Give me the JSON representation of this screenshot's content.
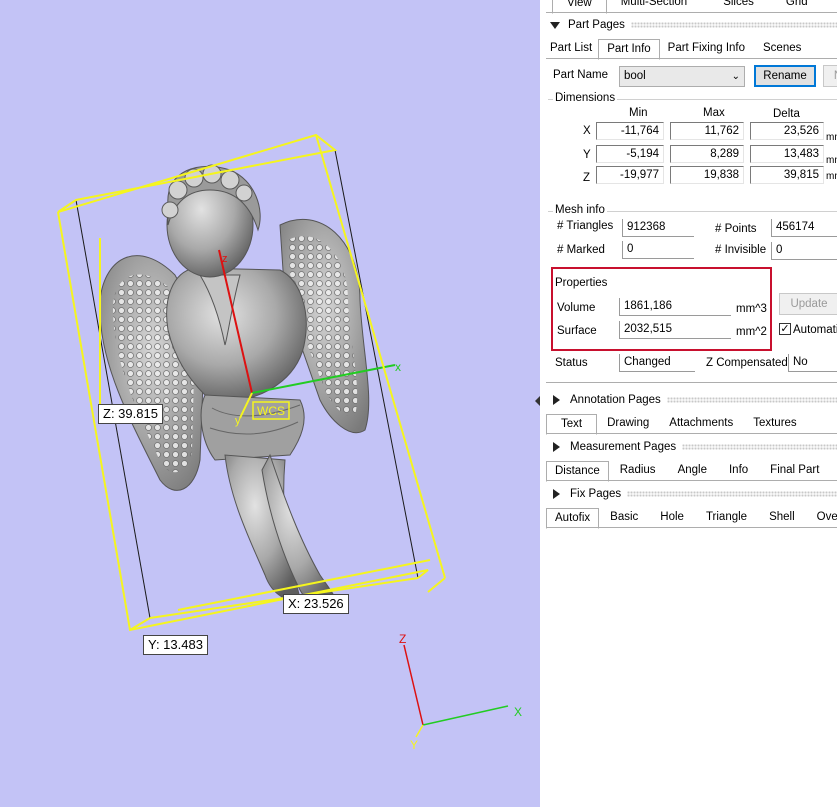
{
  "viewport": {
    "dim_labels": {
      "z": "Z: 39.815",
      "x": "X: 23.526",
      "y": "Y: 13.483"
    },
    "wcs_label": "WCS",
    "local_axes": {
      "x": "x",
      "y": "y",
      "z": "z"
    },
    "global_axes": {
      "x": "X",
      "y": "Y",
      "z": "Z"
    },
    "colors": {
      "background": "#c3c3f6",
      "bbox": "#f5f51e",
      "x_axis": "#22cc22",
      "z_axis": "#dd1111",
      "y_axis": "#f5f51e"
    }
  },
  "panel": {
    "top_tabs": [
      "View",
      "Multi-Section",
      "Slices",
      "Grid"
    ],
    "part_pages": {
      "title": "Part Pages",
      "tabs": [
        "Part List",
        "Part Info",
        "Part Fixing Info",
        "Scenes"
      ],
      "active_tab": "Part Info",
      "part_name_label": "Part Name",
      "part_name_value": "bool",
      "rename_label": "Rename",
      "next_button_label": "N",
      "dimensions": {
        "title": "Dimensions",
        "headers": [
          "Min",
          "Max",
          "Delta"
        ],
        "rows": [
          {
            "axis": "X",
            "min": "-11,764",
            "max": "11,762",
            "delta": "23,526",
            "unit": "mm"
          },
          {
            "axis": "Y",
            "min": "-5,194",
            "max": "8,289",
            "delta": "13,483",
            "unit": "mm"
          },
          {
            "axis": "Z",
            "min": "-19,977",
            "max": "19,838",
            "delta": "39,815",
            "unit": "mm"
          }
        ]
      },
      "mesh_info": {
        "title": "Mesh info",
        "triangles_label": "# Triangles",
        "triangles_value": "912368",
        "points_label": "# Points",
        "points_value": "456174",
        "marked_label": "# Marked",
        "marked_value": "0",
        "invisible_label": "# Invisible",
        "invisible_value": "0"
      },
      "properties": {
        "title": "Properties",
        "volume_label": "Volume",
        "volume_value": "1861,186",
        "volume_unit": "mm^3",
        "surface_label": "Surface",
        "surface_value": "2032,515",
        "surface_unit": "mm^2",
        "update_label": "Update",
        "automatic_label": "Automatic",
        "automatic_checked": true,
        "highlight_color": "#c8102e"
      },
      "status_label": "Status",
      "status_value": "Changed",
      "zcomp_label": "Z Compensated",
      "zcomp_value": "No"
    },
    "annotation_pages": {
      "title": "Annotation Pages",
      "tabs": [
        "Text",
        "Drawing",
        "Attachments",
        "Textures"
      ],
      "active_tab": "Text"
    },
    "measurement_pages": {
      "title": "Measurement Pages",
      "tabs": [
        "Distance",
        "Radius",
        "Angle",
        "Info",
        "Final Part"
      ],
      "active_tab": "Distance"
    },
    "fix_pages": {
      "title": "Fix Pages",
      "tabs": [
        "Autofix",
        "Basic",
        "Hole",
        "Triangle",
        "Shell",
        "Ove"
      ],
      "active_tab": "Autofix"
    }
  }
}
